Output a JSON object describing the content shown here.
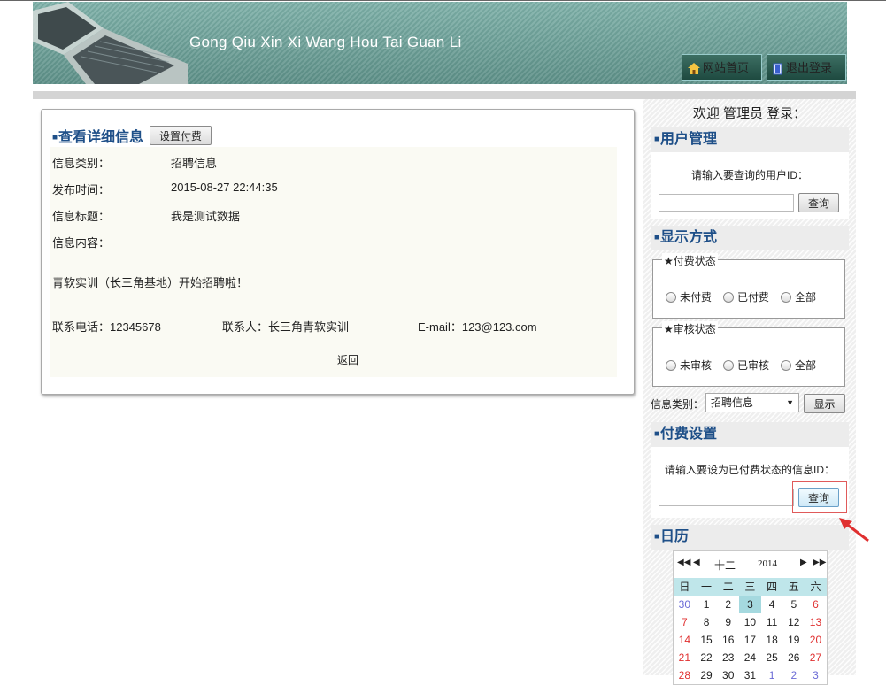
{
  "header": {
    "site_title": "Gong Qiu Xin Xi Wang Hou Tai Guan Li",
    "home_label": "网站首页",
    "logout_label": "退出登录",
    "home_icon": "home-icon",
    "logout_icon": "exit-icon"
  },
  "detail": {
    "title": "查看详细信息",
    "set_fee_button": "设置付费",
    "fields": {
      "category_label": "信息类别：",
      "category_value": "招聘信息",
      "time_label": "发布时间：",
      "time_value": "2015-08-27 22:44:35",
      "subject_label": "信息标题：",
      "subject_value": "我是测试数据",
      "content_label": "信息内容："
    },
    "content_text": "青软实训（长三角基地）开始招聘啦！",
    "phone": "联系电话：12345678",
    "contact": "联系人：长三角青软实训",
    "email": "E-mail：123@123.com",
    "back_link": "返回"
  },
  "sidebar": {
    "welcome": "欢迎 管理员 登录：",
    "user_mgmt": {
      "title": "用户管理",
      "hint": "请输入要查询的用户ID：",
      "input_value": "",
      "button": "查询"
    },
    "display": {
      "title": "显示方式",
      "pay_status_legend": "★付费状态",
      "pay_options": [
        "未付费",
        "已付费",
        "全部"
      ],
      "audit_status_legend": "★审核状态",
      "audit_options": [
        "未审核",
        "已审核",
        "全部"
      ],
      "category_label": "信息类别：",
      "category_selected": "招聘信息",
      "show_button": "显示"
    },
    "payment": {
      "title": "付费设置",
      "hint": "请输入要设为已付费状态的信息ID：",
      "input_value": "",
      "button": "查询"
    },
    "calendar": {
      "title": "日历",
      "month": "十二",
      "year": "2014",
      "weekdays": [
        "日",
        "一",
        "二",
        "三",
        "四",
        "五",
        "六"
      ],
      "weeks": [
        [
          "30",
          "1",
          "2",
          "3",
          "4",
          "5",
          "6"
        ],
        [
          "7",
          "8",
          "9",
          "10",
          "11",
          "12",
          "13"
        ],
        [
          "14",
          "15",
          "16",
          "17",
          "18",
          "19",
          "20"
        ],
        [
          "21",
          "22",
          "23",
          "24",
          "25",
          "26",
          "27"
        ],
        [
          "28",
          "29",
          "30",
          "31",
          "1",
          "2",
          "3"
        ]
      ],
      "today": "3"
    }
  },
  "colors": {
    "accent_blue": "#1e4f88",
    "banner_teal": "#6aa49b",
    "highlight_red": "#e05a5a"
  }
}
